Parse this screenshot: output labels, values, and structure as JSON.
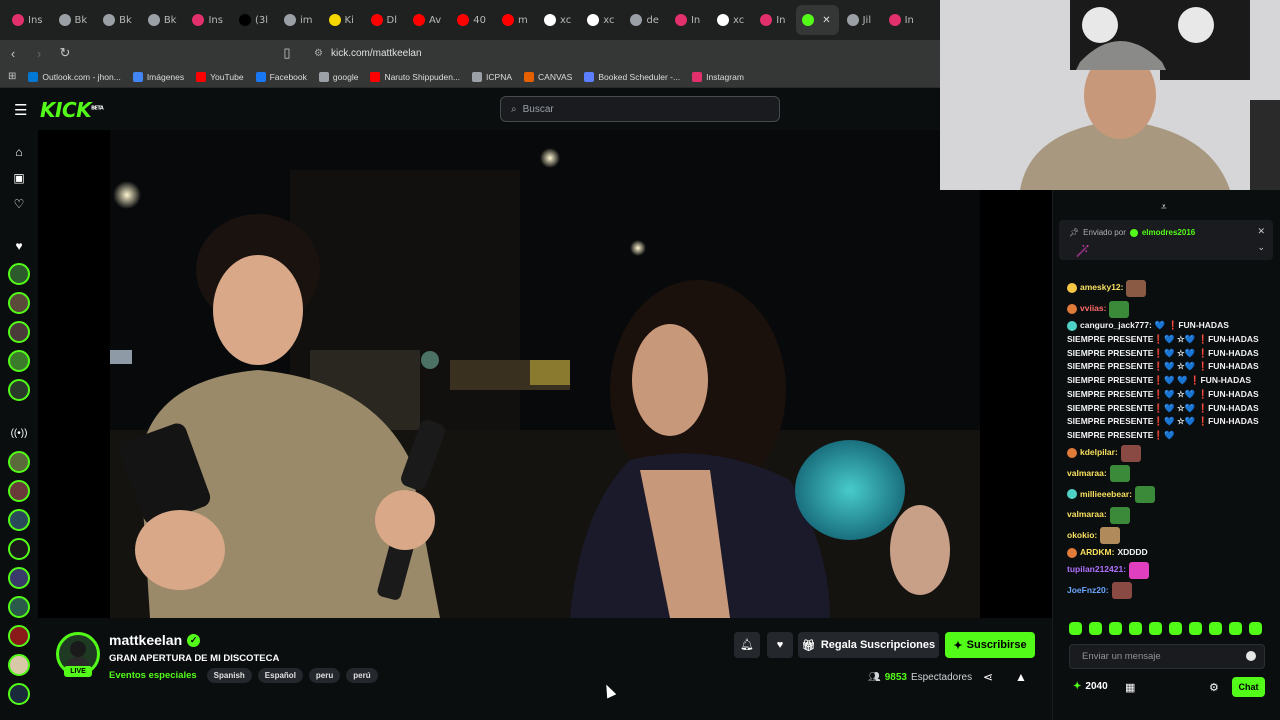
{
  "browser": {
    "tabs": [
      {
        "label": "Ins",
        "color": "#e1306c"
      },
      {
        "label": "Bk",
        "color": "#9aa0a6"
      },
      {
        "label": "Bk",
        "color": "#9aa0a6"
      },
      {
        "label": "Bk",
        "color": "#9aa0a6"
      },
      {
        "label": "Ins",
        "color": "#e1306c"
      },
      {
        "label": "(3l",
        "color": "#000000"
      },
      {
        "label": "im",
        "color": "#9aa0a6"
      },
      {
        "label": "Ki",
        "color": "#f5d800"
      },
      {
        "label": "Dl",
        "color": "#ff0000"
      },
      {
        "label": "Av",
        "color": "#ff0000"
      },
      {
        "label": "40",
        "color": "#ff0000"
      },
      {
        "label": "m",
        "color": "#ff0000"
      },
      {
        "label": "xc",
        "color": "#ffffff"
      },
      {
        "label": "xc",
        "color": "#ffffff"
      },
      {
        "label": "de",
        "color": "#9aa0a6"
      },
      {
        "label": "In",
        "color": "#e1306c"
      },
      {
        "label": "xc",
        "color": "#ffffff"
      },
      {
        "label": "In",
        "color": "#e1306c"
      },
      {
        "label": "",
        "color": "#53fc18",
        "active": true
      },
      {
        "label": "Jil",
        "color": "#9aa0a6"
      },
      {
        "label": "In",
        "color": "#e1306c"
      }
    ],
    "url": "kick.com/mattkeelan",
    "bookmarks": [
      {
        "label": "Outlook.com - jhon...",
        "color": "#0078d4"
      },
      {
        "label": "Imágenes",
        "color": "#4285f4"
      },
      {
        "label": "YouTube",
        "color": "#ff0000"
      },
      {
        "label": "Facebook",
        "color": "#1877f2"
      },
      {
        "label": "google",
        "color": "#9aa0a6"
      },
      {
        "label": "Naruto Shippuden...",
        "color": "#ff0000"
      },
      {
        "label": "ICPNA",
        "color": "#9aa0a6"
      },
      {
        "label": "CANVAS",
        "color": "#e66000"
      },
      {
        "label": "Booked Scheduler -...",
        "color": "#5b7fff"
      },
      {
        "label": "Instagram",
        "color": "#e1306c"
      }
    ]
  },
  "header": {
    "logo": "KICK",
    "logo_sup": "BETA",
    "search_placeholder": "Buscar"
  },
  "channel": {
    "name": "mattkeelan",
    "live_label": "LIVE",
    "title": "GRAN APERTURA DE MI DISCOTECA",
    "category": "Eventos especiales",
    "tags": [
      "Spanish",
      "Español",
      "peru",
      "perú"
    ],
    "gift_label": "Regala Suscripciones",
    "subscribe_label": "Suscribirse",
    "viewer_count": "9853",
    "viewer_label": "Espectadores"
  },
  "chat": {
    "pinned_prefix": "Enviado por",
    "pinned_user": "elmodres2016",
    "messages": [
      {
        "user": "amesky12:",
        "color": "#f6e05e",
        "badge": "#f6c744",
        "text": "",
        "emote": "#8a5a44"
      },
      {
        "user": "vviias:",
        "color": "#ff6b6b",
        "badge": "#e07b39",
        "text": "",
        "emote": "#3a8a3a"
      },
      {
        "user": "canguro_jack777:",
        "color": "#f2f2f2",
        "badge": "#4fd1c5",
        "text": "💙 ❗FUN-HADAS"
      },
      {
        "user": "",
        "color": "#f2f2f2",
        "text": "SIEMPRE PRESENTE❗💙 ☆💙 ❗FUN-HADAS"
      },
      {
        "user": "",
        "color": "#f2f2f2",
        "text": "SIEMPRE PRESENTE❗💙 ☆💙 ❗FUN-HADAS"
      },
      {
        "user": "",
        "color": "#f2f2f2",
        "text": "SIEMPRE PRESENTE❗💙 ☆💙 ❗FUN-HADAS"
      },
      {
        "user": "",
        "color": "#f2f2f2",
        "text": "SIEMPRE PRESENTE❗💙 💙 ❗FUN-HADAS"
      },
      {
        "user": "",
        "color": "#f2f2f2",
        "text": "SIEMPRE PRESENTE❗💙 ☆💙 ❗FUN-HADAS"
      },
      {
        "user": "",
        "color": "#f2f2f2",
        "text": "SIEMPRE PRESENTE❗💙 ☆💙 ❗FUN-HADAS"
      },
      {
        "user": "",
        "color": "#f2f2f2",
        "text": "SIEMPRE PRESENTE❗💙 ☆💙 ❗FUN-HADAS"
      },
      {
        "user": "",
        "color": "#f2f2f2",
        "text": "SIEMPRE PRESENTE❗💙"
      },
      {
        "user": "kdelpilar:",
        "color": "#f6e05e",
        "badge": "#e07b39",
        "text": "",
        "emote": "#8a4a44"
      },
      {
        "user": "valmaraa:",
        "color": "#f6e05e",
        "text": "",
        "emote": "#3a8a3a"
      },
      {
        "user": "millieeebear:",
        "color": "#f6e05e",
        "badge": "#4fd1c5",
        "text": "",
        "emote": "#3a8a3a"
      },
      {
        "user": "valmaraa:",
        "color": "#f6e05e",
        "text": "",
        "emote": "#3a8a3a"
      },
      {
        "user": "okokio:",
        "color": "#f6e05e",
        "text": "",
        "emote": "#b08a5a"
      },
      {
        "user": "ARDKM:",
        "color": "#f6e05e",
        "badge": "#e07b39",
        "text": "XDDDD"
      },
      {
        "user": "tupilan212421:",
        "color": "#b070ff",
        "text": "",
        "emote": "#e040c0"
      },
      {
        "user": "JoeFnz20:",
        "color": "#6aa7ff",
        "text": "",
        "emote": "#8a4a44"
      }
    ],
    "input_placeholder": "Enviar un mensaje",
    "points": "2040",
    "chat_button": "Chat"
  }
}
